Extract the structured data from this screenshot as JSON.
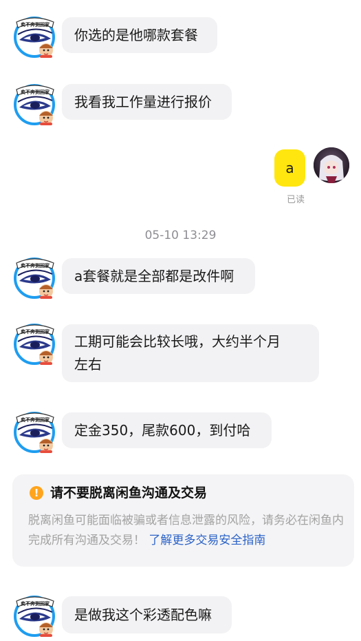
{
  "messages": [
    {
      "text": "你选的是他哪款套餐"
    },
    {
      "text": "我看我工作量进行报价"
    },
    {
      "text": "a",
      "status": "已读"
    },
    {
      "text": "a套餐就是全部都是改件啊"
    },
    {
      "text_line1": "工期可能会比较长哦，大约半个月",
      "text_line2": "左右"
    },
    {
      "text": "定金350，尾款600，到付哈"
    },
    {
      "text": "是做我这个彩透配色嘛"
    }
  ],
  "timestamp": "05-10 13:29",
  "seller_avatar": {
    "badge_text": "卖不奔到回家"
  },
  "notice": {
    "title": "请不要脱离闲鱼沟通及交易",
    "body": "脱离闲鱼可能面临被骗或者信息泄露的风险，请务必在闲鱼内完成所有沟通及交易！",
    "link": "了解更多交易安全指南",
    "icon": "warning-icon"
  },
  "colors": {
    "my_bubble": "#ffe60f",
    "other_bubble": "#f2f2f4",
    "link": "#2c63c8",
    "warning": "#ffa41c"
  }
}
